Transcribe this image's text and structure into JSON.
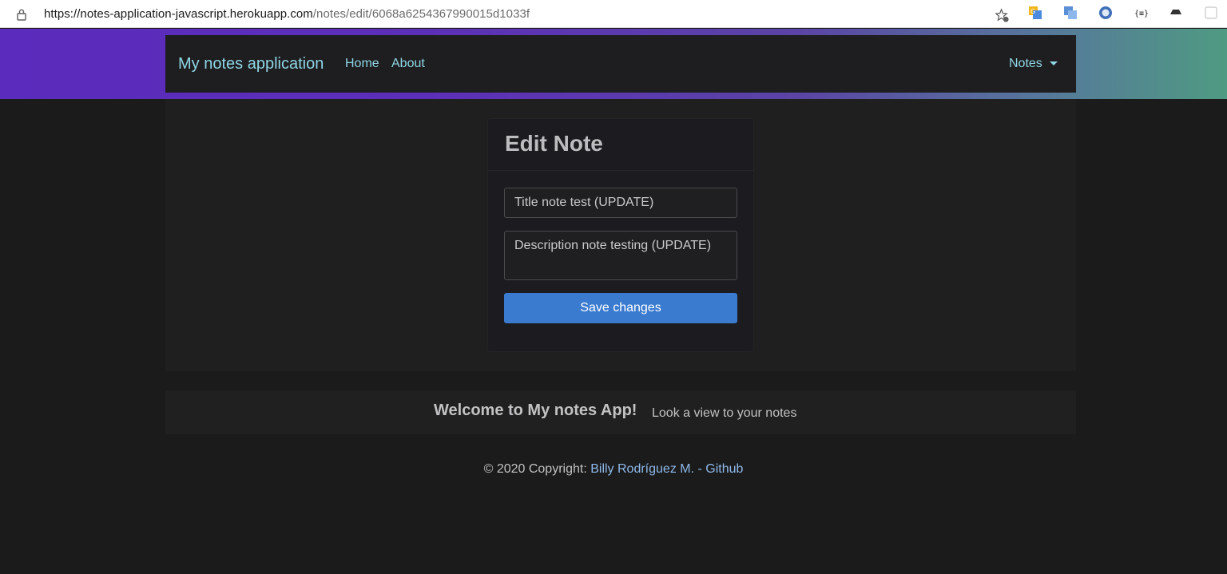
{
  "browser": {
    "url_host": "https://notes-application-javascript.herokuapp.com",
    "url_path": "/notes/edit/6068a6254367990015d1033f"
  },
  "navbar": {
    "brand": "My notes application",
    "links": {
      "home": "Home",
      "about": "About",
      "notes": "Notes"
    }
  },
  "form": {
    "heading": "Edit Note",
    "title_value": "Title note test (UPDATE)",
    "description_value": "Description note testing (UPDATE)",
    "save_label": "Save changes"
  },
  "footer": {
    "welcome": "Welcome to My notes App!",
    "tagline": "Look a view to your notes",
    "copyright_prefix": "© 2020 Copyright: ",
    "copyright_link": "Billy Rodríguez M. - Github"
  },
  "colors": {
    "accent_link": "#8fd6e4",
    "primary_button": "#3a7bd0",
    "background": "#1b1b1c"
  }
}
